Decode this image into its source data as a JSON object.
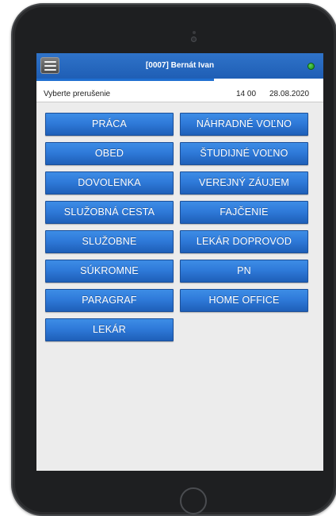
{
  "header": {
    "title": "[0007] Bernát Ivan",
    "status_color": "#1a9e1a"
  },
  "info": {
    "prompt": "Vyberte prerušenie",
    "time": "14 00",
    "date": "28.08.2020"
  },
  "buttons": {
    "left": [
      "PRÁCA",
      "OBED",
      "DOVOLENKA",
      "SLUŽOBNÁ CESTA",
      "SLUŽOBNE",
      "SÚKROMNE",
      "PARAGRAF",
      "LEKÁR"
    ],
    "right": [
      "NÁHRADNÉ VOĽNO",
      "ŠTUDIJNÉ VOĽNO",
      "VEREJNÝ ZÁUJEM",
      "FAJČENIE",
      "LEKÁR DOPROVOD",
      "PN",
      "HOME OFFICE"
    ]
  },
  "colors": {
    "header_blue": "#1f5eb5",
    "button_blue": "#2f7ad9",
    "screen_background": "#ececec"
  },
  "icons": [
    "hamburger-menu-icon",
    "status-indicator-icon",
    "camera-icon",
    "home-button-icon"
  ]
}
